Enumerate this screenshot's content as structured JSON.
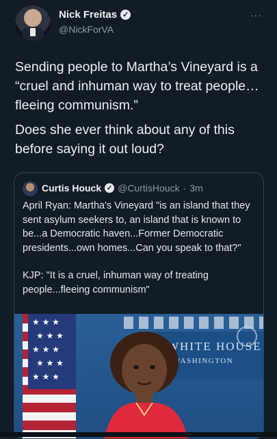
{
  "tweet": {
    "author_name": "Nick Freitas",
    "author_handle": "@NickForVA",
    "more_icon": "more-dots-icon",
    "paragraphs": [
      "Sending people to Martha’s Vineyard is a “cruel and inhuman way to treat people…fleeing communism.”",
      "Does she ever think about any of this before saying it out loud?"
    ]
  },
  "quote": {
    "author_name": "Curtis Houck",
    "author_handle": "@CurtisHouck",
    "separator": "·",
    "time": "3m",
    "paragraphs": [
      "April Ryan: Martha's Vineyard \"is an island that they sent asylum seekers to, an island that is known to be...a Democratic haven...Former Democratic presidents...own homes...Can you speak to that?\"",
      "KJP: \"It is a cruel, inhuman way of treating people...fleeing communism\""
    ],
    "media": {
      "sign_main": "WHITE HOUSE",
      "sign_sub": "WASHINGTON"
    }
  },
  "colors": {
    "background": "#111c26",
    "text": "#e7e9ea",
    "muted": "#8b98a5",
    "border": "#38444d"
  }
}
